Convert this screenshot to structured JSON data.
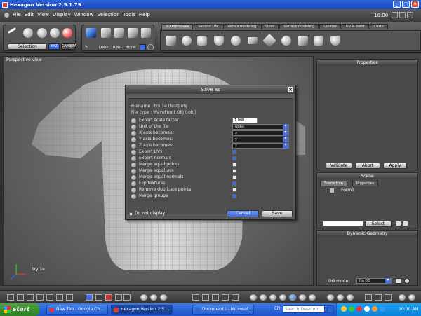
{
  "window": {
    "title": "Hexagon Version 2.5.1.79",
    "min": "_",
    "max": "□",
    "close": "✕"
  },
  "menu": [
    "File",
    "Edit",
    "View",
    "Display",
    "Window",
    "Selection",
    "Tools",
    "Help"
  ],
  "header_time": "10:00",
  "toolbar": {
    "selection_label": "Selection",
    "xyz_label": "XYZ",
    "camera_label": "CAMERA",
    "loop_label": "LOOP",
    "ring_label": "RING",
    "betw_label": "BETW",
    "tabs": [
      "3D Primitives",
      "Second Life",
      "Vertex modeling",
      "Lines",
      "Surface modeling",
      "Utilities",
      "UV & Paint",
      "Custo"
    ]
  },
  "viewport": {
    "label": "Perspective view",
    "object_label": "try 1e"
  },
  "properties": {
    "title": "Properties",
    "validate": "Validate",
    "abort": "Abort",
    "apply": "Apply"
  },
  "scene": {
    "title": "Scene",
    "tab_tree": "Scene tree",
    "tab_props": "Properties",
    "item": "Form1",
    "select": "Select"
  },
  "dynamic": {
    "title": "Dynamic Geometry",
    "dg_label": "DG mode:",
    "dg_value": "No DG"
  },
  "dialog": {
    "title": "Save as",
    "filename": "Filename : try 1e (test).obj",
    "filetype": "File type : WaveFront Obj  (.obj)",
    "options": [
      {
        "label": "Export scale factor",
        "kind": "input",
        "value": "1.000"
      },
      {
        "label": "Unit of the file",
        "kind": "select",
        "value": "None"
      },
      {
        "label": "X axis becomes:",
        "kind": "select",
        "value": "x"
      },
      {
        "label": "Y axis becomes:",
        "kind": "select",
        "value": "y"
      },
      {
        "label": "Z axis becomes:",
        "kind": "select",
        "value": "z"
      },
      {
        "label": "Export UVs",
        "kind": "check",
        "value": true
      },
      {
        "label": "Export normals",
        "kind": "check",
        "value": true
      },
      {
        "label": "Merge equal points",
        "kind": "check",
        "value": false
      },
      {
        "label": "Merge equal uvs",
        "kind": "check",
        "value": false
      },
      {
        "label": "Merge equal normals",
        "kind": "check",
        "value": false
      },
      {
        "label": "Flip textures",
        "kind": "check",
        "value": true
      },
      {
        "label": "Remove duplicate points",
        "kind": "check",
        "value": false
      },
      {
        "label": "Merge groups",
        "kind": "check",
        "value": true
      }
    ],
    "do_not_display": "Do not display",
    "cancel": "Cancel",
    "save": "Save"
  },
  "taskbar": {
    "start": "start",
    "tasks": [
      "New Tab - Google Ch...",
      "Hexagon Version 2.5....",
      "Document1 - Microsof..."
    ],
    "lang": "EN",
    "search_placeholder": "Search Desktop",
    "clock": "10:00 AM"
  },
  "colors": {
    "accent": "#3b6ae8",
    "titlebar": "#2b63d9",
    "start": "#3a9a34"
  }
}
